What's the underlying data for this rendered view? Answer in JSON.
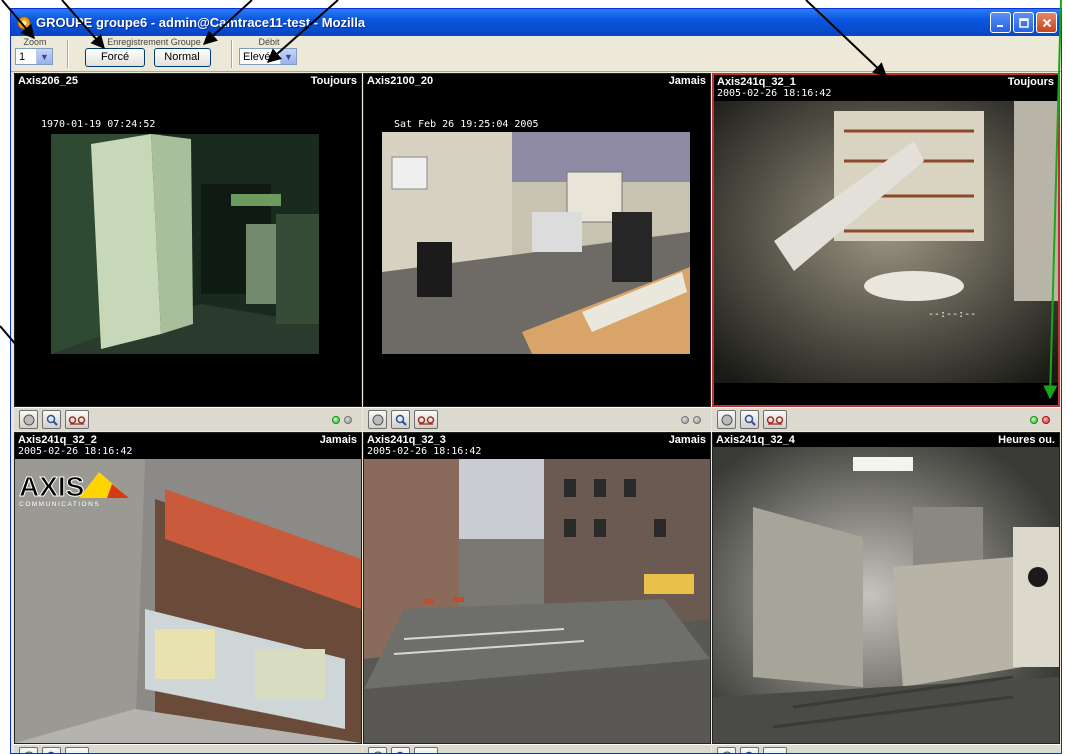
{
  "window": {
    "title": "GROUPE groupe6 - admin@Camtrace11-test - Mozilla",
    "min_icon": "minimize-icon",
    "max_icon": "maximize-icon",
    "close_icon": "close-icon"
  },
  "toolbar": {
    "zoom_label": "Zoom",
    "zoom_value": "1",
    "recording_label": "Enregistrement Groupe",
    "force_button": "Forcé",
    "normal_button": "Normal",
    "rate_label": "Débit",
    "rate_value": "Elevé"
  },
  "cameras": [
    {
      "name": "Axis206_25",
      "mode": "Toujours",
      "date": "",
      "overlay": "1970-01-19 07:24:52",
      "status": [
        "green",
        "grey"
      ],
      "active": false
    },
    {
      "name": "Axis2100_20",
      "mode": "Jamais",
      "date": "",
      "overlay": "Sat Feb 26  19:25:04  2005",
      "status": [
        "grey",
        "grey"
      ],
      "active": false
    },
    {
      "name": "Axis241q_32_1",
      "mode": "Toujours",
      "date": "2005-02-26 18:16:42",
      "overlay": "--:--:--",
      "status": [
        "green",
        "red"
      ],
      "active": true
    },
    {
      "name": "Axis241q_32_2",
      "mode": "Jamais",
      "date": "2005-02-26 18:16:42",
      "overlay": "",
      "status": [
        "green",
        "grey"
      ],
      "active": false
    },
    {
      "name": "Axis241q_32_3",
      "mode": "Jamais",
      "date": "2005-02-26 18:16:42",
      "overlay": "",
      "status": [
        "grey",
        "grey"
      ],
      "active": false
    },
    {
      "name": "Axis241q_32_4",
      "mode": "Heures ou.",
      "date": "",
      "overlay": "",
      "status": [
        "grey",
        "grey"
      ],
      "active": false
    }
  ],
  "logo": {
    "brand": "AXIS",
    "sub": "COMMUNICATIONS"
  },
  "camera_controls": [
    "snapshot-icon",
    "zoom-magnifier-icon",
    "playback-tape-icon"
  ],
  "colors": {
    "title_bar": "#0a55e0",
    "chrome": "#ece9d8",
    "active_border": "#c03030",
    "status_green": "#22b522",
    "status_red": "#dd1b1b",
    "arrow_black": "#000000",
    "arrow_green": "#1aa51a"
  }
}
